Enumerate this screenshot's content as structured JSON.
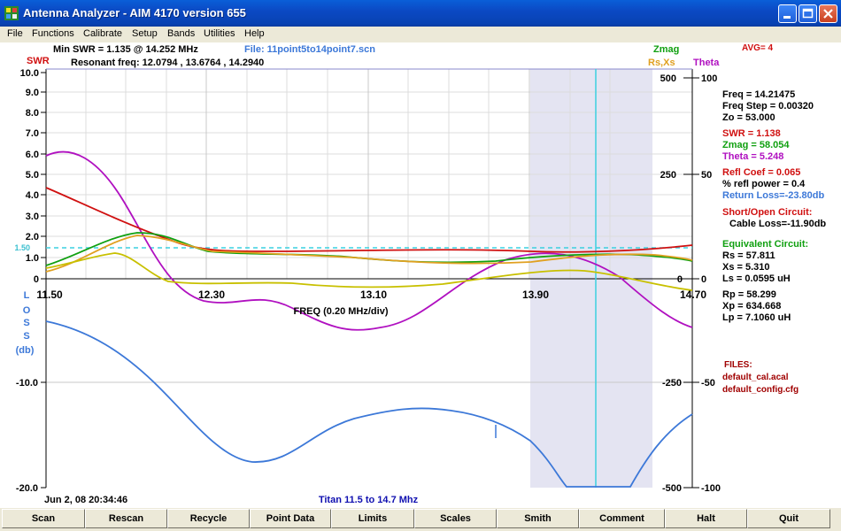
{
  "window": {
    "title": "Antenna Analyzer  -   AIM 4170 version 655"
  },
  "menu": [
    "File",
    "Functions",
    "Calibrate",
    "Setup",
    "Bands",
    "Utilities",
    "Help"
  ],
  "header": {
    "min_swr": "Min SWR =  1.135 @  14.252 MHz",
    "file": "File: 11point5to14point7.scn",
    "resonant": "Resonant freq:  12.0794 , 13.6764 , 14.2940",
    "zmag_label": "Zmag",
    "avg": "AVG=  4",
    "swr_label": "SWR",
    "rsxs_label": "Rs,Xs",
    "theta_label": "Theta"
  },
  "plot": {
    "swr_ticks": [
      "10.0",
      "9.0",
      "8.0",
      "7.0",
      "6.0",
      "5.0",
      "4.0",
      "3.0",
      "2.0",
      "1.0",
      "0"
    ],
    "swr_ref": "1.50",
    "z_ticks": [
      "500",
      "250",
      "0"
    ],
    "theta_ticks": [
      "100",
      "50",
      "0"
    ],
    "freq_ticks": [
      "11.50",
      "12.30",
      "13.10",
      "13.90",
      "14.70"
    ],
    "freq_caption": "FREQ (0.20 MHz/div)",
    "loss_axis_label": [
      "L",
      "O",
      "S",
      "S",
      "(db)"
    ],
    "loss_ticks": [
      "-10.0",
      "-20.0"
    ],
    "lower_z_ticks": [
      "-250",
      "-500"
    ],
    "lower_theta_ticks": [
      "-50",
      "-100"
    ],
    "date": "Jun 2, 08   20:34:46",
    "caption": "Titan 11.5 to 14.7 Mhz"
  },
  "readout": {
    "freq": "Freq =  14.21475",
    "freq_step": "Freq Step =  0.00320",
    "zo": "Zo =   53.000",
    "swr": "SWR  =   1.138",
    "zmag": "Zmag =   58.054",
    "theta": "Theta =    5.248",
    "refl_coef": "Refl Coef   = 0.065",
    "refl_power": "% refl power =  0.4",
    "return_loss": "Return Loss=-23.80db",
    "short_open": "Short/Open Circuit:",
    "cable_loss": "Cable Loss=-11.90db",
    "equiv": "Equivalent Circuit:",
    "rs": "Rs =   57.811",
    "xs": "Xs =    5.310",
    "ls": "Ls =    0.0595  uH",
    "rp": "Rp =   58.299",
    "xp": "Xp =  634.668",
    "lp": "Lp =    7.1060  uH",
    "files_title": "FILES:",
    "file1": "default_cal.acal",
    "file2": "default_config.cfg"
  },
  "buttons": [
    "Scan",
    "Rescan",
    "Recycle",
    "Point Data",
    "Limits",
    "Scales",
    "Smith",
    "Comment",
    "Halt",
    "Quit"
  ],
  "colors": {
    "swr": "#d01010",
    "zmag": "#10a010",
    "rs": "#e0a020",
    "xs": "#c8c000",
    "theta": "#b010c0",
    "loss": "#3c78d8",
    "cursor": "#3cd0e0",
    "band": "#e4e4f2"
  }
}
